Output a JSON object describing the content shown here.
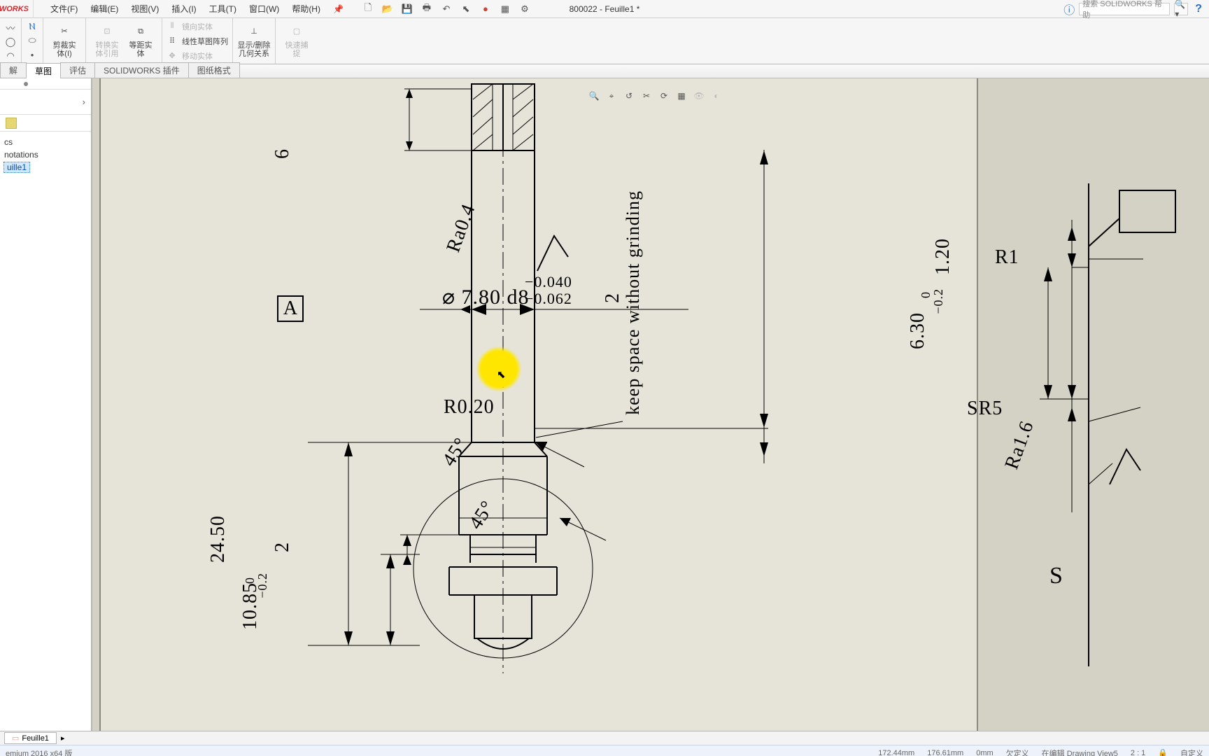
{
  "logo": "WORKS",
  "menus": {
    "file": "文件(F)",
    "edit": "编辑(E)",
    "view": "视图(V)",
    "insert": "插入(I)",
    "tools": "工具(T)",
    "window": "窗口(W)",
    "help": "帮助(H)"
  },
  "doc_title": "800022 - Feuille1 *",
  "search_placeholder": "搜索 SOLIDWORKS 帮助",
  "ribbon": {
    "trim": "剪裁实\n体(I)",
    "convert": "转换实\n体引用",
    "offset": "等距实\n体",
    "mirror": "镜向实体",
    "pattern": "线性草图阵列",
    "move": "移动实体",
    "relations": "显示/删除\n几何关系",
    "quicksnap": "快速捕\n捉"
  },
  "tabs": {
    "annot": "解",
    "sketch": "草图",
    "eval": "评估",
    "plugin": "SOLIDWORKS 插件",
    "format": "图纸格式"
  },
  "tree": {
    "pcs": "cs",
    "annot": "notations",
    "sheet": "uille1"
  },
  "dims": {
    "top6": "6",
    "ra04": "Ra0.4",
    "dia": "⌀ 7.80 d8",
    "tol_u": "−0.040",
    "tol_l": "−0.062",
    "two": "2",
    "keep": "keep space without grinding",
    "r020": "R0.20",
    "a45a": "45°",
    "a45b": "45°",
    "h2450": "24.50",
    "h1085": "10.85",
    "h2": "2",
    "tol0": "0",
    "toln02": "−0.2",
    "r1": "R1",
    "v120": "1.20",
    "v0": "0",
    "vneg02": "−0.2",
    "v630": "6.30",
    "sr5": "SR5",
    "ra16": "Ra1.6",
    "s": "S"
  },
  "datum": "A",
  "sheet_tab": "Feuille1",
  "statusbar": {
    "edition": "emium 2016 x64 版",
    "x": "172.44mm",
    "y": "176.61mm",
    "z": "0mm",
    "fix": "欠定义",
    "editing": "在编辑 Drawing View5",
    "ratio": "2 : 1",
    "custom": "自定义"
  }
}
